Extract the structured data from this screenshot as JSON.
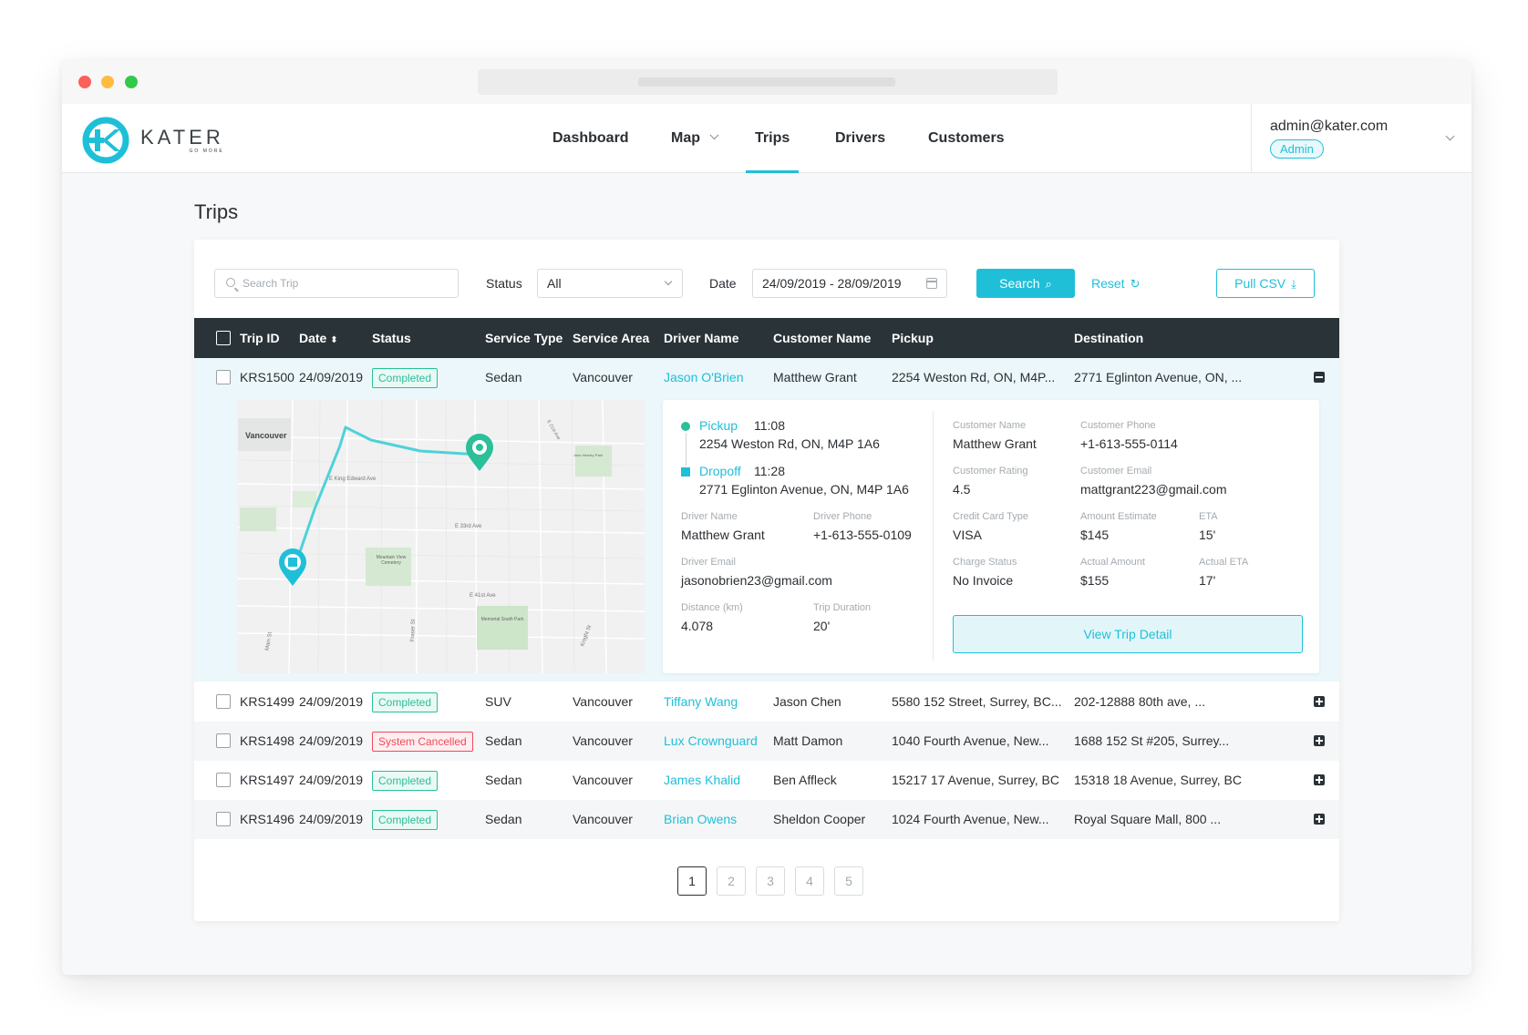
{
  "nav": {
    "brand": "KATER",
    "brand_tagline": "GO MORE",
    "items": [
      {
        "label": "Dashboard"
      },
      {
        "label": "Map"
      },
      {
        "label": "Trips"
      },
      {
        "label": "Drivers"
      },
      {
        "label": "Customers"
      }
    ],
    "active": "Trips",
    "user_email": "admin@kater.com",
    "user_role": "Admin"
  },
  "page": {
    "title": "Trips"
  },
  "filters": {
    "search_placeholder": "Search Trip",
    "status_label": "Status",
    "status_value": "All",
    "date_label": "Date",
    "date_value": "24/09/2019 - 28/09/2019",
    "search_button": "Search",
    "reset_button": "Reset",
    "csv_button": "Pull CSV"
  },
  "table": {
    "columns": [
      "Trip ID",
      "Date",
      "Status",
      "Service Type",
      "Service Area",
      "Driver Name",
      "Customer Name",
      "Pickup",
      "Destination"
    ],
    "rows": [
      {
        "id": "KRS1500",
        "date": "24/09/2019",
        "status": "Completed",
        "service_type": "Sedan",
        "area": "Vancouver",
        "driver": "Jason O'Brien",
        "customer": "Matthew Grant",
        "pickup": "2254 Weston Rd, ON, M4P...",
        "destination": "2771 Eglinton Avenue, ON, ..."
      },
      {
        "id": "KRS1499",
        "date": "24/09/2019",
        "status": "Completed",
        "service_type": "SUV",
        "area": "Vancouver",
        "driver": "Tiffany Wang",
        "customer": "Jason Chen",
        "pickup": "5580 152 Street, Surrey, BC...",
        "destination": "202-12888 80th ave, ..."
      },
      {
        "id": "KRS1498",
        "date": "24/09/2019",
        "status": "System Cancelled",
        "service_type": "Sedan",
        "area": "Vancouver",
        "driver": "Lux Crownguard",
        "customer": "Matt Damon",
        "pickup": "1040 Fourth Avenue, New...",
        "destination": "1688 152 St #205, Surrey..."
      },
      {
        "id": "KRS1497",
        "date": "24/09/2019",
        "status": "Completed",
        "service_type": "Sedan",
        "area": "Vancouver",
        "driver": "James Khalid",
        "customer": "Ben Affleck",
        "pickup": "15217 17 Avenue, Surrey, BC",
        "destination": "15318 18 Avenue, Surrey, BC"
      },
      {
        "id": "KRS1496",
        "date": "24/09/2019",
        "status": "Completed",
        "service_type": "Sedan",
        "area": "Vancouver",
        "driver": "Brian Owens",
        "customer": "Sheldon Cooper",
        "pickup": "1024 Fourth Avenue, New...",
        "destination": "Royal Square Mall, 800 ..."
      }
    ]
  },
  "detail": {
    "pickup_label": "Pickup",
    "pickup_time": "11:08",
    "pickup_address": "2254 Weston Rd, ON, M4P 1A6",
    "dropoff_label": "Dropoff",
    "dropoff_time": "11:28",
    "dropoff_address": "2771 Eglinton Avenue, ON, M4P 1A6",
    "driver_name_label": "Driver Name",
    "driver_name": "Matthew Grant",
    "driver_phone_label": "Driver Phone",
    "driver_phone": "+1-613-555-0109",
    "driver_email_label": "Driver Email",
    "driver_email": "jasonobrien23@gmail.com",
    "distance_label": "Distance (km)",
    "distance": "4.078",
    "duration_label": "Trip Duration",
    "duration": "20'",
    "customer_name_label": "Customer Name",
    "customer_name": "Matthew Grant",
    "customer_phone_label": "Customer Phone",
    "customer_phone": "+1-613-555-0114",
    "customer_rating_label": "Customer Rating",
    "customer_rating": "4.5",
    "customer_email_label": "Customer Email",
    "customer_email": "mattgrant223@gmail.com",
    "cc_type_label": "Credit Card Type",
    "cc_type": "VISA",
    "amount_est_label": "Amount Estimate",
    "amount_est": "$145",
    "eta_label": "ETA",
    "eta": "15'",
    "charge_status_label": "Charge Status",
    "charge_status": "No Invoice",
    "actual_amount_label": "Actual Amount",
    "actual_amount": "$155",
    "actual_eta_label": "Actual ETA",
    "actual_eta": "17'",
    "view_button": "View Trip Detail"
  },
  "map": {
    "labels": [
      "Vancouver",
      "E King Edward Ave",
      "E 33rd Ave",
      "E 41st Ave",
      "Mountain View Cemetery",
      "Memorial South Park",
      "Main St",
      "Fraser St",
      "Knight St",
      "E 21st Ave",
      "John Hendry Park"
    ]
  },
  "pagination": [
    "1",
    "2",
    "3",
    "4",
    "5"
  ],
  "colors": {
    "accent": "#1fbfd8",
    "completed": "#2bbf9a",
    "cancelled": "#ef4b5b",
    "header": "#2a3338"
  }
}
